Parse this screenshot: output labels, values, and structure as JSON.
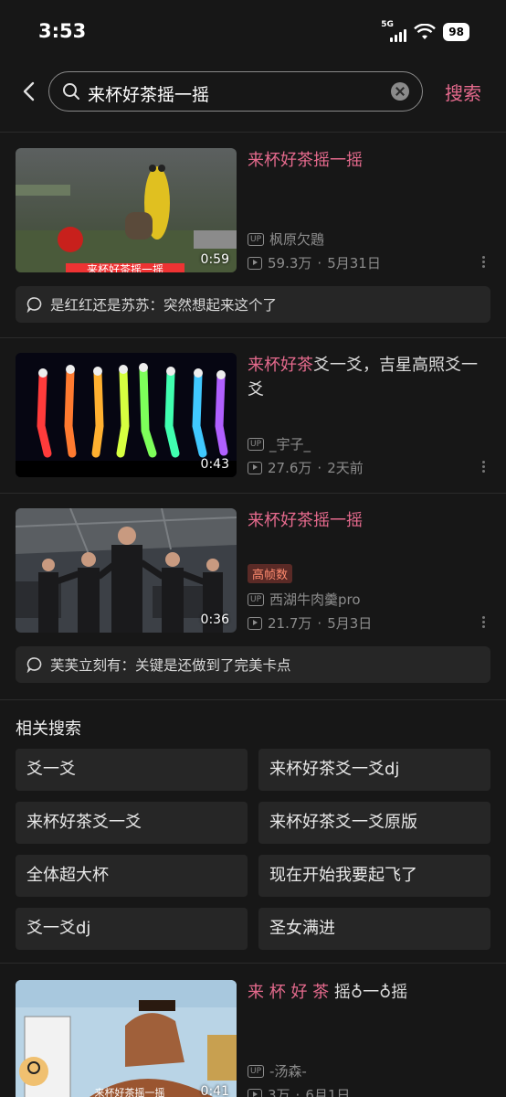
{
  "status_bar": {
    "time": "3:53",
    "network": "5G",
    "battery": "98"
  },
  "search": {
    "query": "来杯好茶摇一摇",
    "button": "搜索"
  },
  "videos": [
    {
      "title_highlight": "来杯好茶摇一摇",
      "title_rest": "",
      "duration": "0:59",
      "uploader": "枫原欠鶗",
      "views": "59.3万",
      "date": "5月31日",
      "thumb_caption": "来杯好茶摇一摇",
      "comment": "是红红还是苏苏：突然想起来这个了"
    },
    {
      "title_highlight": "来杯好茶",
      "title_rest": "爻一爻，吉星高照爻一爻",
      "duration": "0:43",
      "uploader": "_宇子_",
      "views": "27.6万",
      "date": "2天前"
    },
    {
      "title_highlight": "来杯好茶摇一摇",
      "title_rest": "",
      "duration": "0:36",
      "tag": "高帧数",
      "uploader": "西湖牛肉羹pro",
      "views": "21.7万",
      "date": "5月3日",
      "comment": "芙芙立刻有：关键是还做到了完美卡点"
    },
    {
      "title_highlight": "来 杯 好 茶",
      "title_rest": " 摇♁一♁摇",
      "duration": "0:41",
      "uploader": "-汤森-",
      "views": "3万",
      "date": "6月1日",
      "thumb_caption": "来杯好茶摇一摇"
    }
  ],
  "related": {
    "title": "相关搜索",
    "items": [
      "爻一爻",
      "来杯好茶爻一爻dj",
      "来杯好茶爻一爻",
      "来杯好茶爻一爻原版",
      "全体超大杯",
      "现在开始我要起飞了",
      "爻一爻dj",
      "圣女满进"
    ]
  },
  "colors": {
    "accent": "#e56a8d",
    "background": "#171717",
    "chip": "#262626"
  },
  "icons": {
    "back": "chevron-left-icon",
    "search": "search-icon",
    "clear": "clear-icon",
    "up": "up-badge-icon",
    "play": "play-count-icon",
    "comment": "comment-icon",
    "more": "more-vertical-icon"
  }
}
